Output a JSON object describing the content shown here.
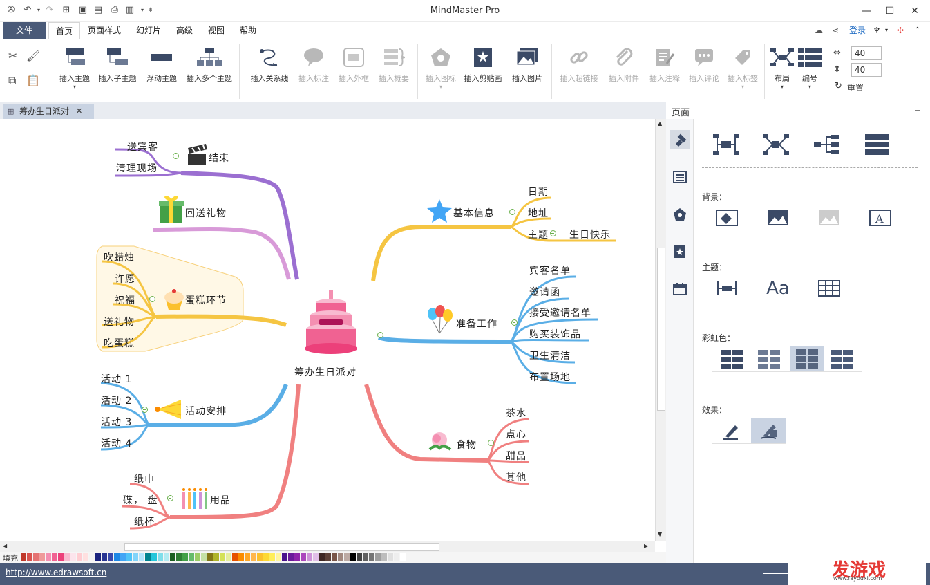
{
  "app": {
    "title": "MindMaster Pro"
  },
  "menubar": {
    "file": "文件",
    "tabs": [
      "首页",
      "页面样式",
      "幻灯片",
      "高级",
      "视图",
      "帮助"
    ],
    "login": "登录"
  },
  "ribbon": {
    "buttons": [
      {
        "label": "插入主题",
        "enabled": true
      },
      {
        "label": "插入子主题",
        "enabled": true
      },
      {
        "label": "浮动主题",
        "enabled": true
      },
      {
        "label": "插入多个主题",
        "enabled": true
      },
      {
        "label": "插入关系线",
        "enabled": true
      },
      {
        "label": "插入标注",
        "enabled": false
      },
      {
        "label": "插入外框",
        "enabled": false
      },
      {
        "label": "插入概要",
        "enabled": false
      },
      {
        "label": "插入图标",
        "enabled": false
      },
      {
        "label": "插入剪贴画",
        "enabled": true
      },
      {
        "label": "插入图片",
        "enabled": true
      },
      {
        "label": "插入超链接",
        "enabled": false
      },
      {
        "label": "插入附件",
        "enabled": false
      },
      {
        "label": "插入注释",
        "enabled": false
      },
      {
        "label": "插入评论",
        "enabled": false
      },
      {
        "label": "插入标签",
        "enabled": false
      },
      {
        "label": "布局",
        "enabled": true
      },
      {
        "label": "编号",
        "enabled": true
      }
    ],
    "spacing_h": "40",
    "spacing_v": "40",
    "reset": "重置"
  },
  "document": {
    "tab": "筹办生日派对"
  },
  "mindmap": {
    "center": "筹办生日派对",
    "branches": {
      "end": {
        "label": "结束",
        "children": [
          "送宾客",
          "清理现场"
        ],
        "color": "#9b6fd1"
      },
      "gift": {
        "label": "回送礼物",
        "children": [],
        "color": "#d89ad8"
      },
      "cake": {
        "label": "蛋糕环节",
        "children": [
          "吹蜡烛",
          "许愿",
          "祝福",
          "送礼物",
          "吃蛋糕"
        ],
        "color": "#f5c542"
      },
      "activity": {
        "label": "活动安排",
        "children": [
          "活动 1",
          "活动 2",
          "活动 3",
          "活动 4"
        ],
        "color": "#5aaee6"
      },
      "supplies": {
        "label": "用品",
        "children": [
          "纸巾",
          "碟， 盘",
          "纸杯"
        ],
        "color": "#f08080"
      },
      "info": {
        "label": "基本信息",
        "children": [
          "日期",
          "地址",
          "主题"
        ],
        "sub": "生日快乐",
        "color": "#f5c542"
      },
      "prep": {
        "label": "准备工作",
        "children": [
          "宾客名单",
          "邀请函",
          "接受邀请名单",
          "购买装饰品",
          "卫生清洁",
          "布置场地"
        ],
        "color": "#5aaee6"
      },
      "food": {
        "label": "食物",
        "children": [
          "茶水",
          "点心",
          "甜品",
          "其他"
        ],
        "color": "#f08080"
      }
    }
  },
  "palette": {
    "label": "填充",
    "colors": [
      "#c0392b",
      "#d9534f",
      "#e57373",
      "#ef9a9a",
      "#f48fb1",
      "#f06292",
      "#ec407a",
      "#f8bbd0",
      "#fce4ec",
      "#ffcdd2",
      "#ffe0e0",
      "#f3f3f3",
      "#1a237e",
      "#283593",
      "#3949ab",
      "#1e88e5",
      "#42a5f5",
      "#4fc3f7",
      "#81d4fa",
      "#b3e5fc",
      "#00838f",
      "#26c6da",
      "#80deea",
      "#b2ebf2",
      "#1b5e20",
      "#2e7d32",
      "#43a047",
      "#66bb6a",
      "#9ccc65",
      "#c5e1a5",
      "#827717",
      "#afb42b",
      "#d4e157",
      "#e6ee9c",
      "#e65100",
      "#fb8c00",
      "#ffa726",
      "#ffb74d",
      "#fbc02d",
      "#fdd835",
      "#ffee58",
      "#fff59d",
      "#4a148c",
      "#6a1b9a",
      "#8e24aa",
      "#ab47bc",
      "#ce93d8",
      "#e1bee7",
      "#3e2723",
      "#5d4037",
      "#795548",
      "#a1887f",
      "#bcaaa4",
      "#000000",
      "#424242",
      "#616161",
      "#757575",
      "#9e9e9e",
      "#bdbdbd",
      "#e0e0e0",
      "#eeeeee",
      "#ffffff"
    ]
  },
  "status": {
    "url": "http://www.edrawsoft.cn"
  },
  "panel": {
    "header": "页面",
    "background_label": "背景：",
    "theme_label": "主题：",
    "rainbow_label": "彩虹色：",
    "effect_label": "效果："
  },
  "watermark": {
    "main": "发游戏",
    "sub": "www.fayouxi.com"
  }
}
